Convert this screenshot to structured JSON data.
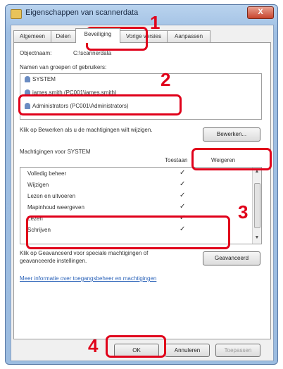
{
  "window": {
    "title": "Eigenschappen van scannerdata",
    "close_glyph": "X"
  },
  "tabs": [
    "Algemeen",
    "Delen",
    "Beveiliging",
    "Vorige versies",
    "Aanpassen"
  ],
  "object": {
    "label": "Objectnaam:",
    "value": "C:\\scannerdata"
  },
  "groups": {
    "label": "Namen van groepen of gebruikers:",
    "items": [
      "SYSTEM",
      "james.smith (PC001\\james.smith)",
      "Administrators (PC001\\Administrators)"
    ]
  },
  "edit": {
    "hint": "Klik op Bewerken als u de machtigingen wilt wijzigen.",
    "button": "Bewerken..."
  },
  "permissions": {
    "header": "Machtigingen voor SYSTEM",
    "allow_label": "Toestaan",
    "deny_label": "Weigeren",
    "rows": [
      {
        "name": "Volledig beheer",
        "check": "✓"
      },
      {
        "name": "Wijzigen",
        "check": "✓"
      },
      {
        "name": "Lezen en uitvoeren",
        "check": "✓"
      },
      {
        "name": "Mapinhoud weergeven",
        "check": "✓"
      },
      {
        "name": "Lezen",
        "check": "✓"
      },
      {
        "name": "Schrijven",
        "check": "✓"
      }
    ]
  },
  "advanced": {
    "hint": "Klik op Geavanceerd voor speciale machtigingen of geavanceerde instellingen.",
    "button": "Geavanceerd"
  },
  "more_info_link": "Meer informatie over toegangsbeheer en machtigingen",
  "footer": {
    "ok": "OK",
    "cancel": "Annuleren",
    "apply": "Toepassen"
  },
  "callouts": [
    "1",
    "2",
    "3",
    "4"
  ],
  "colors": {
    "callout": "#e0001a",
    "link": "#2a62b8"
  }
}
